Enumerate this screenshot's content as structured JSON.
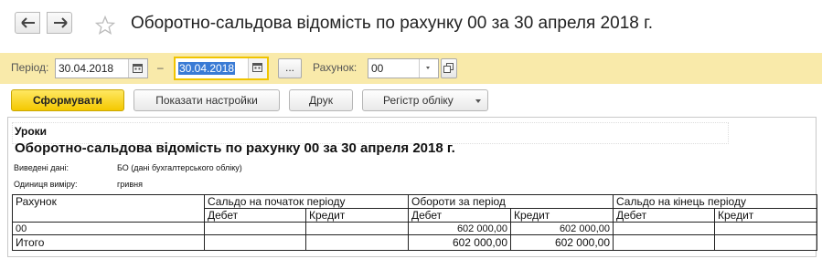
{
  "window": {
    "title": "Оборотно-сальдова відомість по рахунку 00 за 30 апреля 2018 г."
  },
  "filters": {
    "period_label": "Період:",
    "date_from": "30.04.2018",
    "dash": "–",
    "date_to": "30.04.2018",
    "ellipsis": "...",
    "account_label": "Рахунок:",
    "account_value": "00"
  },
  "toolbar": {
    "generate": "Сформувати",
    "show_settings": "Показати настройки",
    "print": "Друк",
    "ledger_register": "Регістр обліку"
  },
  "report": {
    "company": "Уроки",
    "heading": "Оборотно-сальдова відомість по рахунку 00 за 30 апреля 2018 г.",
    "output_label": "Виведені дані:",
    "output_value": "БО (дані бухгалтерського обліку)",
    "unit_label": "Одиниця виміру:",
    "unit_value": "гривня",
    "table": {
      "account_header": "Рахунок",
      "opening_header": "Сальдо на початок періоду",
      "turnover_header": "Обороти за період",
      "closing_header": "Сальдо на кінець періоду",
      "debit": "Дебет",
      "credit": "Кредит",
      "row": {
        "account": "00",
        "opening_debit": "",
        "opening_credit": "",
        "turnover_debit": "602 000,00",
        "turnover_credit": "602 000,00",
        "closing_debit": "",
        "closing_credit": ""
      },
      "total": {
        "label": "Итого",
        "opening_debit": "",
        "opening_credit": "",
        "turnover_debit": "602 000,00",
        "turnover_credit": "602 000,00",
        "closing_debit": "",
        "closing_credit": ""
      }
    }
  }
}
